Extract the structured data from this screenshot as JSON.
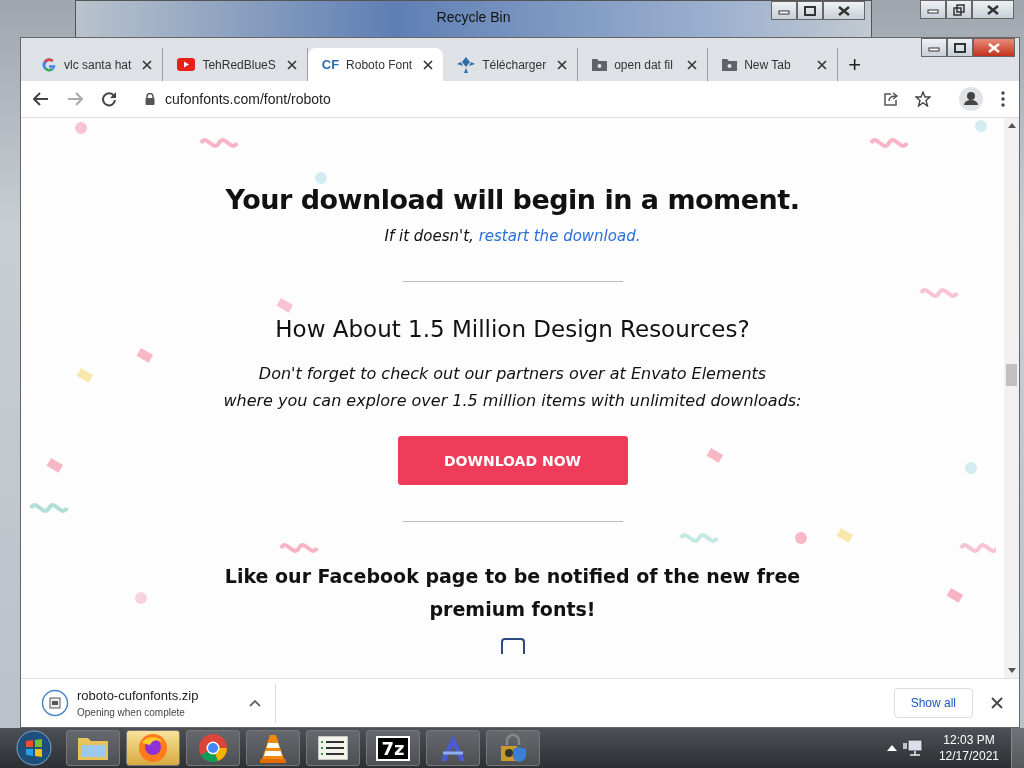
{
  "background_window": {
    "title": "Recycle Bin"
  },
  "browser": {
    "tabs": [
      {
        "kind": "google",
        "label": "vlc santa hat",
        "selected": false
      },
      {
        "kind": "youtube",
        "label": "TehRedBlueS",
        "selected": false
      },
      {
        "kind": "cf",
        "icon_text": "CF",
        "label": "Roboto Font",
        "selected": true
      },
      {
        "kind": "diamond",
        "label": "Télécharger",
        "selected": false
      },
      {
        "kind": "folder",
        "label": "open dat fil",
        "selected": false
      },
      {
        "kind": "folder",
        "label": "New Tab",
        "selected": false
      }
    ],
    "new_tab": "+",
    "address": "cufonfonts.com/font/roboto"
  },
  "page": {
    "heading": "Your download will begin in a moment.",
    "restart_prefix": "If it doesn't,",
    "restart_link": "restart the download.",
    "promo_title": "How About 1.5 Million Design Resources?",
    "promo_lines": [
      "Don't forget to check out our partners over at Envato Elements",
      "where you can explore over 1.5 million items with unlimited downloads:"
    ],
    "download_button": "DOWNLOAD NOW",
    "facebook_text": "Like our Facebook page to be notified of the new free premium fonts!"
  },
  "download_bar": {
    "file": "roboto-cufonfonts.zip",
    "status": "Opening when complete",
    "show_all": "Show all"
  },
  "taskbar": {
    "apps": [
      {
        "kind": "folder",
        "selected": false
      },
      {
        "kind": "firefox",
        "selected": true
      },
      {
        "kind": "chrome",
        "selected": false
      },
      {
        "kind": "vlc",
        "selected": false
      },
      {
        "kind": "list",
        "selected": false
      },
      {
        "kind": "sevenzip",
        "label": "7z",
        "selected": false
      },
      {
        "kind": "letter",
        "selected": false
      },
      {
        "kind": "lock",
        "selected": false
      }
    ],
    "time": "12:03 PM",
    "date": "12/17/2021"
  }
}
